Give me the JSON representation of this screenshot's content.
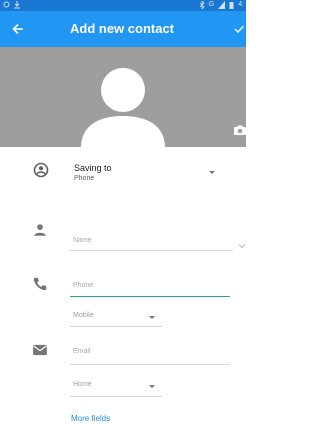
{
  "status_bar": {
    "left_icons": [
      "notification-icon",
      "download-icon"
    ],
    "right_icons": [
      "bluetooth-icon",
      "signal-icon",
      "battery-icon"
    ],
    "network": "G",
    "time_partial": "4:"
  },
  "app_bar": {
    "back_icon": "arrow-left-icon",
    "title": "Add new contact",
    "confirm_icon": "check-icon",
    "color": "#2196f3"
  },
  "photo": {
    "background": "#9e9e9e",
    "avatar_icon": "person-silhouette-icon",
    "camera_icon": "camera-icon"
  },
  "saving_to": {
    "icon": "account-circle-icon",
    "title": "Saving to",
    "account": "Phone"
  },
  "name_field": {
    "icon": "person-icon",
    "placeholder": "Name",
    "expand_icon": "chevron-down-icon"
  },
  "phone_field": {
    "icon": "phone-icon",
    "placeholder": "Phone",
    "type_selected": "Mobile"
  },
  "email_field": {
    "icon": "email-icon",
    "placeholder": "Email",
    "type_selected": "Home"
  },
  "more_fields_label": "More fields",
  "accent_color": "#26a69a"
}
